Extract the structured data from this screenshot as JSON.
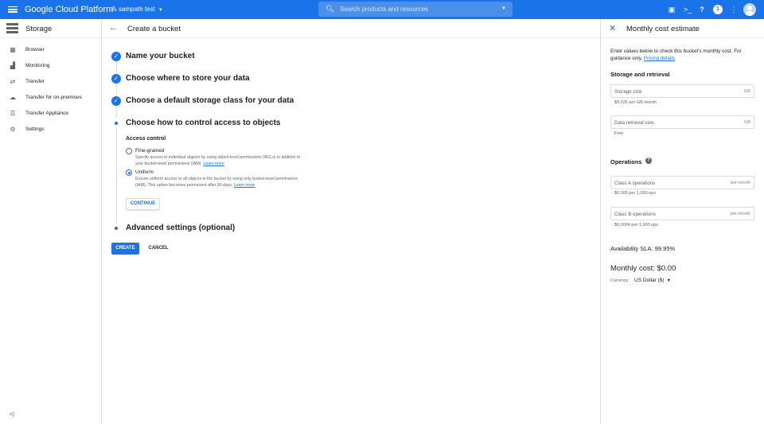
{
  "topbar": {
    "logo": "Google Cloud Platform",
    "project": "sampath test",
    "search_placeholder": "Search products and resources",
    "notification_count": "1",
    "accent_color": "#1a73e8",
    "icons": [
      "menu-icon",
      "project-icon",
      "search-icon",
      "gift-icon",
      "terminal-icon",
      "help-icon",
      "notification-icon",
      "more-vert-icon",
      "account-avatar"
    ]
  },
  "sidebar": {
    "title": "Storage",
    "items": [
      {
        "label": "Browser",
        "icon": "browser-icon"
      },
      {
        "label": "Monitoring",
        "icon": "monitoring-icon"
      },
      {
        "label": "Transfer",
        "icon": "transfer-icon"
      },
      {
        "label": "Transfer for on-premises",
        "icon": "cloud-upload-icon"
      },
      {
        "label": "Transfer Appliance",
        "icon": "appliance-icon"
      },
      {
        "label": "Settings",
        "icon": "gear-icon"
      }
    ]
  },
  "main": {
    "title": "Create a bucket",
    "steps": [
      {
        "title": "Name your bucket",
        "state": "done"
      },
      {
        "title": "Choose where to store your data",
        "state": "done"
      },
      {
        "title": "Choose a default storage class for your data",
        "state": "done"
      },
      {
        "title": "Choose how to control access to objects",
        "state": "active"
      },
      {
        "title": "Advanced settings (optional)",
        "state": "pending"
      }
    ],
    "access_control": {
      "title": "Access control",
      "options": [
        {
          "label": "Fine-grained",
          "desc": "Specify access to individual objects by using object-level permissions (ACLs) in addition to your bucket-level permissions (IAM).",
          "link": "Learn more",
          "selected": false
        },
        {
          "label": "Uniform",
          "desc": "Ensure uniform access to all objects in the bucket by using only bucket-level permissions (IAM). This option becomes permanent after 90 days.",
          "link": "Learn more",
          "selected": true
        }
      ],
      "continue_label": "CONTINUE"
    },
    "create_label": "CREATE",
    "cancel_label": "CANCEL"
  },
  "panel": {
    "title": "Monthly cost estimate",
    "intro": "Enter values below to check this bucket's monthly cost. For guidance only.",
    "intro_link": "Pricing details",
    "storage_section": "Storage and retrieval",
    "storage_size": {
      "placeholder": "Storage size",
      "suffix": "GB",
      "hint": "$0.026 per GB-month"
    },
    "retrieval_size": {
      "placeholder": "Data retrieval size",
      "suffix": "GB",
      "hint": "Free"
    },
    "operations_section": "Operations",
    "class_a": {
      "placeholder": "Class A operations",
      "suffix": "per-month",
      "hint": "$0.005 per 1,000 ops"
    },
    "class_b": {
      "placeholder": "Class B operations",
      "suffix": "per-month",
      "hint": "$0.0004 per 1,000 ops"
    },
    "sla": "Availability SLA: 99.95%",
    "monthly_cost": "Monthly cost: $0.00",
    "currency_label": "Currency:",
    "currency_value": "US Dollar ($)"
  }
}
